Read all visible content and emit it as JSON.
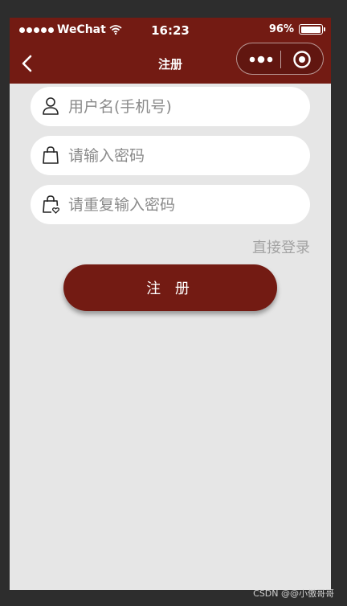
{
  "status_bar": {
    "carrier": "WeChat",
    "time": "16:23",
    "battery": "96%",
    "battery_level": 0.96
  },
  "nav": {
    "title": "注册",
    "back_icon": "chevron-left-icon",
    "menu_icon": "more-dots-icon",
    "close_icon": "target-circle-icon"
  },
  "form": {
    "username": {
      "value": "",
      "placeholder": "用户名(手机号)",
      "icon": "user-icon"
    },
    "password": {
      "value": "",
      "placeholder": "请输入密码",
      "icon": "lock-icon"
    },
    "password_repeat": {
      "value": "",
      "placeholder": "请重复输入密码",
      "icon": "lock-heart-icon"
    },
    "login_link": "直接登录",
    "register_button": "注 册"
  },
  "watermark": "CSDN @@小傲哥哥",
  "colors": {
    "brand": "#731b13",
    "background": "#e6e6e6",
    "field": "#ffffff",
    "link": "#a3a3a3"
  }
}
